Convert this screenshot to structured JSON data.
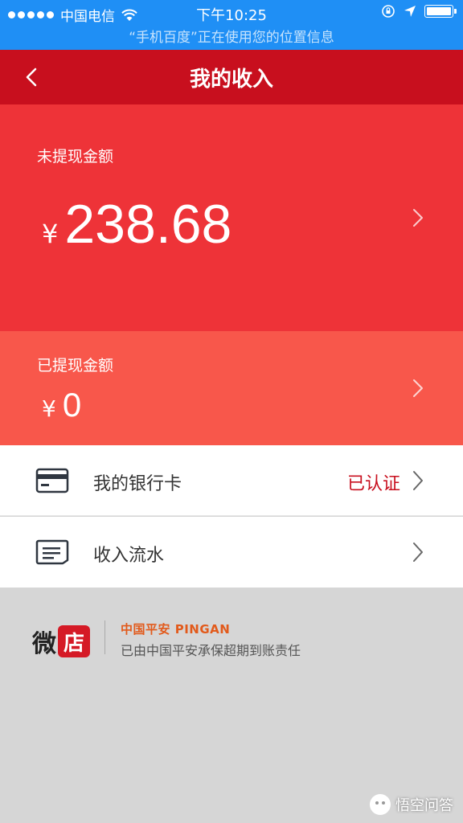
{
  "status_bar": {
    "carrier": "中国电信",
    "time": "下午10:25",
    "location_notice": "“手机百度”正在使用您的位置信息"
  },
  "nav": {
    "title": "我的收入",
    "back_icon": "chevron-left-icon"
  },
  "pending": {
    "label": "未提现金额",
    "currency": "¥",
    "amount": "238.68"
  },
  "withdrawn": {
    "label": "已提现金额",
    "currency": "¥",
    "amount": "0"
  },
  "rows": [
    {
      "icon": "bank-card-icon",
      "label": "我的银行卡",
      "status": "已认证"
    },
    {
      "icon": "statement-icon",
      "label": "收入流水",
      "status": ""
    }
  ],
  "footer": {
    "logo_left": "微",
    "logo_right": "店",
    "insurer": "中国平安 PINGAN",
    "description": "已由中国平安承保超期到账责任"
  },
  "watermark": "悟空问答",
  "colors": {
    "status_bar": "#1f8ff5",
    "nav": "#c80f1e",
    "pending_bg": "#ee3338",
    "withdrawn_bg": "#f8574b",
    "accent_text": "#c80f1e"
  }
}
